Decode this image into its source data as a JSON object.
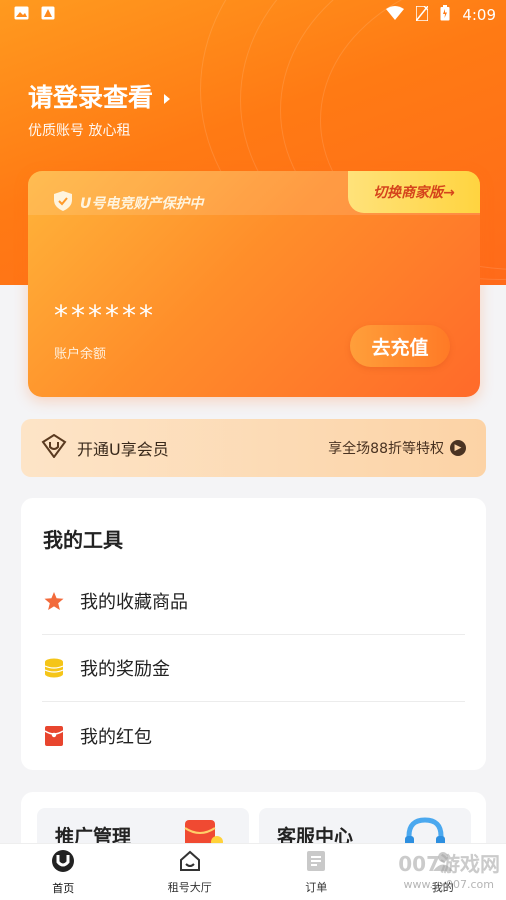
{
  "status_bar": {
    "time": "4:09"
  },
  "header": {
    "login_title": "请登录查看",
    "subtitle": "优质账号 放心租"
  },
  "account_card": {
    "protection_text": "U号电竞财产保护中",
    "switch_label": "切换商家版→",
    "balance_masked": "******",
    "balance_label": "账户余额",
    "recharge_label": "去充值"
  },
  "vip_banner": {
    "label": "开通U享会员",
    "benefit": "享全场88折等特权"
  },
  "tools": {
    "title": "我的工具",
    "items": [
      {
        "label": "我的收藏商品",
        "icon": "star-icon",
        "color": "#f26a3b"
      },
      {
        "label": "我的奖励金",
        "icon": "coin-stack-icon",
        "color": "#f5c518"
      },
      {
        "label": "我的红包",
        "icon": "red-packet-icon",
        "color": "#e8452e"
      }
    ]
  },
  "promo_cards": [
    {
      "label": "推广管理"
    },
    {
      "label": "客服中心"
    }
  ],
  "tab_bar": {
    "tabs": [
      {
        "label": "首页",
        "icon": "u-logo-icon"
      },
      {
        "label": "租号大厅",
        "icon": "home-icon"
      },
      {
        "label": "订单",
        "icon": "document-icon"
      },
      {
        "label": "我的",
        "icon": "user-icon"
      }
    ]
  },
  "watermark": {
    "brand": "007游戏网",
    "url": "www.yx007.com"
  },
  "colors": {
    "accent": "#ff7a14",
    "card": "#ff8e2a",
    "vip_bg": "#fcd3a6"
  }
}
